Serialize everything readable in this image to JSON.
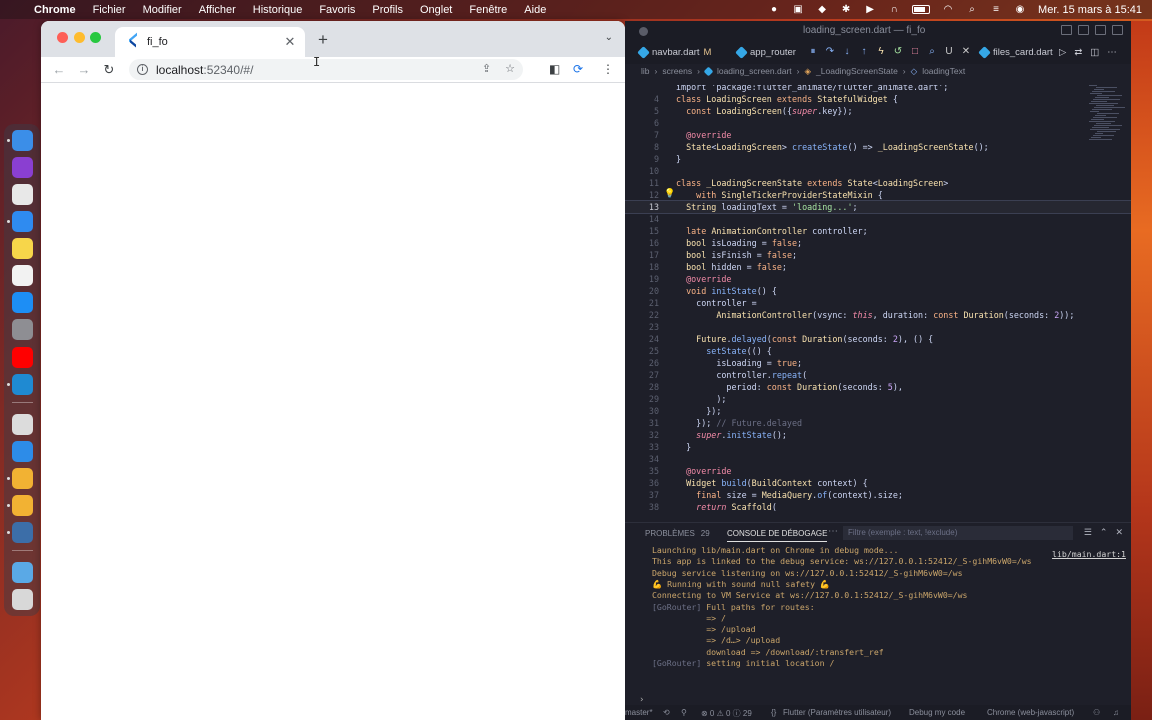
{
  "menubar": {
    "app_name": "Chrome",
    "items": [
      "Fichier",
      "Modifier",
      "Afficher",
      "Historique",
      "Favoris",
      "Profils",
      "Onglet",
      "Fenêtre",
      "Aide"
    ],
    "datetime": "Mer. 15 mars à 15:41"
  },
  "chrome": {
    "tab_title": "fi_fo",
    "url_host": "localhost",
    "url_rest": ":52340/#/"
  },
  "vscode": {
    "window_title": "loading_screen.dart — fi_fo",
    "tabs": [
      {
        "label": "navbar.dart",
        "modified": "M"
      },
      {
        "label": "app_router"
      },
      {
        "label": "files_card.dart"
      }
    ],
    "tab_overflow_label": "U",
    "breadcrumb": [
      "lib",
      "screens",
      "loading_screen.dart",
      "_LoadingScreenState",
      "loadingText"
    ],
    "current_line": "13",
    "panel": {
      "problems_label": "PROBLÈMES",
      "problems_count": "29",
      "console_label": "CONSOLE DE DÉBOGAGE",
      "filter_placeholder": "Filtre (exemple : text, !exclude)",
      "source_link": "lib/main.dart:1",
      "lines": [
        "Launching lib/main.dart on Chrome in debug mode...",
        "This app is linked to the debug service: ws://127.0.0.1:52412/_S-gihM6vW0=/ws",
        "Debug service listening on ws://127.0.0.1:52412/_S-gihM6vW0=/ws",
        "💪 Running with sound null safety 💪",
        "Connecting to VM Service at ws://127.0.0.1:52412/_S-gihM6vW0=/ws",
        "[GoRouter] Full paths for routes:",
        "           => /",
        "           => /upload",
        "           => /d…> /upload",
        "           download => /download/:transfert_ref",
        "[GoRouter] setting initial location /"
      ]
    },
    "statusbar": {
      "branch": "master*",
      "problems": "⊗ 0 ⚠ 0 ⓘ 29",
      "flutter": "Flutter (Paramètres utilisateur)",
      "debug_mode": "Debug my code",
      "device": "Chrome (web-javascript)"
    }
  },
  "code_lines": [
    {
      "n": "",
      "html": "<span class='pl'>import 'package:flutter_animate/flutter_animate.dart';</span>"
    },
    {
      "n": "4",
      "html": "<span class='kw'>class</span> <span class='cls'>LoadingScreen</span> <span class='kw'>extends</span> <span class='cls'>StatefulWidget</span> <span class='pl'>{</span>"
    },
    {
      "n": "5",
      "html": "  <span class='kw'>const</span> <span class='cls'>LoadingScreen</span><span class='pl'>({</span><span class='it'>super</span><span class='pl'>.key});</span>"
    },
    {
      "n": "6",
      "html": ""
    },
    {
      "n": "7",
      "html": "  <span class='ann'>@override</span>"
    },
    {
      "n": "8",
      "html": "  <span class='cls'>State</span><span class='pl'>&lt;</span><span class='cls'>LoadingScreen</span><span class='pl'>&gt;</span> <span class='fn'>createState</span><span class='pl'>() =&gt; </span><span class='cls'>_LoadingScreenState</span><span class='pl'>();</span>"
    },
    {
      "n": "9",
      "html": "<span class='pl'>}</span>"
    },
    {
      "n": "10",
      "html": ""
    },
    {
      "n": "11",
      "html": "<span class='kw'>class</span> <span class='cls'>_LoadingScreenState</span> <span class='kw'>extends</span> <span class='cls'>State</span><span class='pl'>&lt;</span><span class='cls'>LoadingScreen</span><span class='pl'>&gt;</span>"
    },
    {
      "n": "12",
      "html": "    <span class='kw'>with</span> <span class='cls'>SingleTickerProviderStateMixin</span> <span class='pl'>{</span>"
    },
    {
      "n": "13",
      "html": "  <span class='cls'>String</span> <span class='pl'>loadingText = </span><span class='str'>'loading...'</span><span class='pl'>;</span>"
    },
    {
      "n": "14",
      "html": ""
    },
    {
      "n": "15",
      "html": "  <span class='kw'>late</span> <span class='cls'>AnimationController</span> <span class='pl'>controller;</span>"
    },
    {
      "n": "16",
      "html": "  <span class='cls'>bool</span> <span class='pl'>isLoading = </span><span class='bool'>false</span><span class='pl'>;</span>"
    },
    {
      "n": "17",
      "html": "  <span class='cls'>bool</span> <span class='pl'>isFinish = </span><span class='bool'>false</span><span class='pl'>;</span>"
    },
    {
      "n": "18",
      "html": "  <span class='cls'>bool</span> <span class='pl'>hidden = </span><span class='bool'>false</span><span class='pl'>;</span>"
    },
    {
      "n": "19",
      "html": "  <span class='ann'>@override</span>"
    },
    {
      "n": "20",
      "html": "  <span class='kw'>void</span> <span class='fn'>initState</span><span class='pl'>() {</span>"
    },
    {
      "n": "21",
      "html": "    <span class='pl'>controller =</span>"
    },
    {
      "n": "22",
      "html": "        <span class='cls'>AnimationController</span><span class='pl'>(vsync: </span><span class='it'>this</span><span class='pl'>, duration: </span><span class='kw'>const</span> <span class='cls'>Duration</span><span class='pl'>(seconds: </span><span class='num'>2</span><span class='pl'>));</span>"
    },
    {
      "n": "23",
      "html": ""
    },
    {
      "n": "24",
      "html": "    <span class='cls'>Future</span><span class='pl'>.</span><span class='fn'>delayed</span><span class='pl'>(</span><span class='kw'>const</span> <span class='cls'>Duration</span><span class='pl'>(seconds: </span><span class='num'>2</span><span class='pl'>), () {</span>"
    },
    {
      "n": "25",
      "html": "      <span class='fn'>setState</span><span class='pl'>(() {</span>"
    },
    {
      "n": "26",
      "html": "        <span class='pl'>isLoading = </span><span class='bool'>true</span><span class='pl'>;</span>"
    },
    {
      "n": "27",
      "html": "        <span class='pl'>controller.</span><span class='fn'>repeat</span><span class='pl'>(</span>"
    },
    {
      "n": "28",
      "html": "          <span class='pl'>period: </span><span class='kw'>const</span> <span class='cls'>Duration</span><span class='pl'>(seconds: </span><span class='num'>5</span><span class='pl'>),</span>"
    },
    {
      "n": "29",
      "html": "        <span class='pl'>);</span>"
    },
    {
      "n": "30",
      "html": "      <span class='pl'>});</span>"
    },
    {
      "n": "31",
      "html": "    <span class='pl'>}); </span><span class='cm'>// Future.delayed</span>"
    },
    {
      "n": "32",
      "html": "    <span class='it'>super</span><span class='pl'>.</span><span class='fn'>initState</span><span class='pl'>();</span>"
    },
    {
      "n": "33",
      "html": "  <span class='pl'>}</span>"
    },
    {
      "n": "34",
      "html": ""
    },
    {
      "n": "35",
      "html": "  <span class='ann'>@override</span>"
    },
    {
      "n": "36",
      "html": "  <span class='cls'>Widget</span> <span class='fn'>build</span><span class='pl'>(</span><span class='cls'>BuildContext</span> <span class='pl'>context) {</span>"
    },
    {
      "n": "37",
      "html": "    <span class='kw'>final</span> <span class='pl'>size = </span><span class='cls'>MediaQuery</span><span class='pl'>.</span><span class='fn'>of</span><span class='pl'>(context).size;</span>"
    },
    {
      "n": "38",
      "html": "    <span class='it'>return</span> <span class='cls'>Scaffold</span><span class='pl'>(</span>"
    }
  ],
  "dock_apps": [
    {
      "name": "finder",
      "color": "#3b8ee8"
    },
    {
      "name": "siri",
      "color": "#8a3fd1"
    },
    {
      "name": "launchpad",
      "color": "#e8e8e8"
    },
    {
      "name": "safari",
      "color": "#2f8bf0"
    },
    {
      "name": "notes",
      "color": "#f7d64a"
    },
    {
      "name": "freeform",
      "color": "#f2f2f2"
    },
    {
      "name": "app-store",
      "color": "#1d8ef5"
    },
    {
      "name": "system-settings",
      "color": "#8e8e93"
    },
    {
      "name": "youtube",
      "color": "#ff0000"
    },
    {
      "name": "vscode",
      "color": "#1f8ad2"
    },
    {
      "name": "preview",
      "color": "#dcdcdc"
    },
    {
      "name": "keynote",
      "color": "#2d8ce8"
    },
    {
      "name": "chrome",
      "color": "#f2b233"
    },
    {
      "name": "chrome-dev",
      "color": "#f2b233"
    },
    {
      "name": "chrome-canary",
      "color": "#3c6ea8"
    },
    {
      "name": "downloads-folder",
      "color": "#5aa9e6"
    },
    {
      "name": "trash",
      "color": "#d8d8d8"
    }
  ]
}
